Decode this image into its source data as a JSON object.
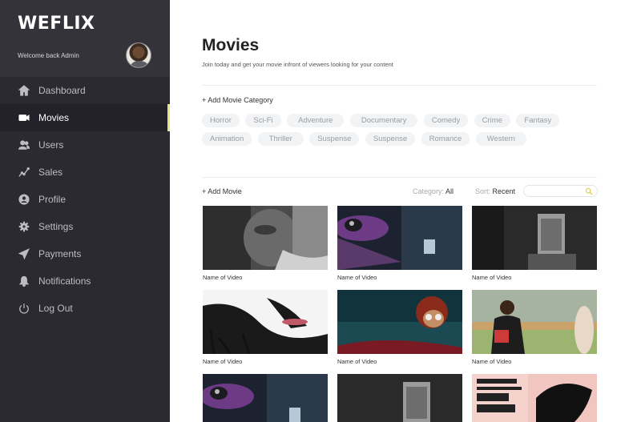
{
  "sidebar": {
    "logo": "WEFLIX",
    "welcome": "Welcome back Admin",
    "items": [
      {
        "label": "Dashboard",
        "icon": "home-icon",
        "active": false
      },
      {
        "label": "Movies",
        "icon": "video-camera-icon",
        "active": true
      },
      {
        "label": "Users",
        "icon": "users-icon",
        "active": false
      },
      {
        "label": "Sales",
        "icon": "chart-line-icon",
        "active": false
      },
      {
        "label": "Profile",
        "icon": "user-circle-icon",
        "active": false
      },
      {
        "label": "Settings",
        "icon": "gear-icon",
        "active": false
      },
      {
        "label": "Payments",
        "icon": "paper-plane-icon",
        "active": false
      },
      {
        "label": "Notifications",
        "icon": "bell-icon",
        "active": false
      },
      {
        "label": "Log Out",
        "icon": "power-icon",
        "active": false
      }
    ]
  },
  "main": {
    "title": "Movies",
    "subtitle": "Join today and get your movie infront of viewers looking for your content",
    "add_category": "+ Add Movie Category",
    "categories": [
      "Horror",
      "Sci-Fi",
      "Adventure",
      "Documentary",
      "Comedy",
      "Crime",
      "Fantasy",
      "Animation",
      "Thriller",
      "Suspense",
      "Suspense",
      "Romance",
      "Western"
    ],
    "add_movie": "+ Add Movie",
    "category_label": "Category:",
    "category_value": "All",
    "sort_label": "Sort:",
    "sort_value": "Recent",
    "search_placeholder": "",
    "videos": [
      {
        "name": "Name of Video"
      },
      {
        "name": "Name of Video"
      },
      {
        "name": "Name of Video"
      },
      {
        "name": "Name of Video"
      },
      {
        "name": "Name of Video"
      },
      {
        "name": "Name of Video"
      },
      {
        "name": ""
      },
      {
        "name": ""
      },
      {
        "name": ""
      }
    ]
  },
  "colors": {
    "sidebar_bg": "#2b2a30",
    "accent": "#e7e58a",
    "search_icon": "#d9d04a"
  }
}
